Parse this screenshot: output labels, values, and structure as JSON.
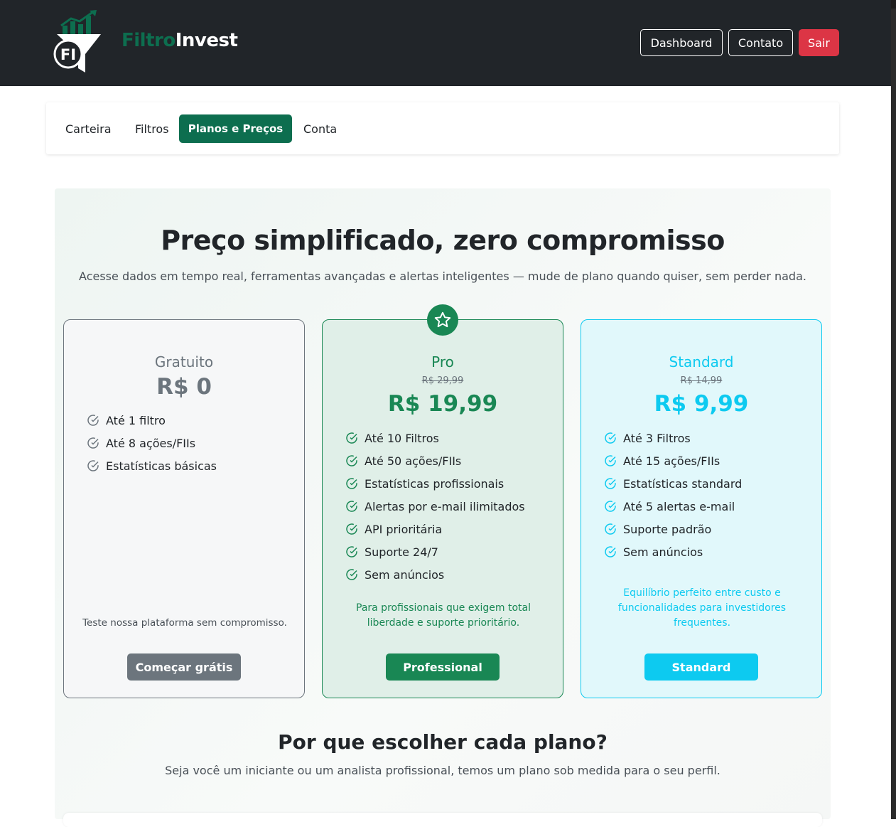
{
  "brand": {
    "part1": "Filtro",
    "part2": "Invest",
    "logo_text": "FI"
  },
  "nav": {
    "dashboard": "Dashboard",
    "contato": "Contato",
    "sair": "Sair"
  },
  "tabs": [
    "Carteira",
    "Filtros",
    "Planos e Preços",
    "Conta"
  ],
  "active_tab": "Planos e Preços",
  "hero": {
    "title": "Preço simplificado, zero compromisso",
    "subtitle": "Acesse dados em tempo real, ferramentas avançadas e alertas inteligentes — mude de plano quando quiser, sem perder nada."
  },
  "plans": [
    {
      "name": "Gratuito",
      "old_price": "",
      "price": "R$ 0",
      "features": [
        "Até 1 filtro",
        "Até 8 ações/FIIs",
        "Estatísticas básicas"
      ],
      "description": "Teste nossa plataforma sem compromisso.",
      "button": "Começar grátis",
      "color": "#6c757d"
    },
    {
      "name": "Pro",
      "old_price": "R$ 29,99",
      "price": "R$ 19,99",
      "features": [
        "Até 10 Filtros",
        "Até 50 ações/FIIs",
        "Estatísticas profissionais",
        "Alertas por e-mail ilimitados",
        "API prioritária",
        "Suporte 24/7",
        "Sem anúncios"
      ],
      "description": "Para profissionais que exigem total liberdade e suporte prioritário.",
      "button": "Professional",
      "color": "#198754",
      "badge_icon": "star-icon"
    },
    {
      "name": "Standard",
      "old_price": "R$ 14,99",
      "price": "R$ 9,99",
      "features": [
        "Até 3 Filtros",
        "Até 15 ações/FIIs",
        "Estatísticas standard",
        "Até 5 alertas e-mail",
        "Suporte padrão",
        "Sem anúncios"
      ],
      "description": "Equilíbrio perfeito entre custo e funcionalidades para investidores frequentes.",
      "button": "Standard",
      "color": "#0dcaf0"
    }
  ],
  "why": {
    "title": "Por que escolher cada plano?",
    "subtitle": "Seja você um iniciante ou um analista profissional, temos um plano sob medida para o seu perfil."
  },
  "colors": {
    "navbar": "#212529",
    "brand_green": "#0d6e4f",
    "danger": "#dc3545"
  }
}
